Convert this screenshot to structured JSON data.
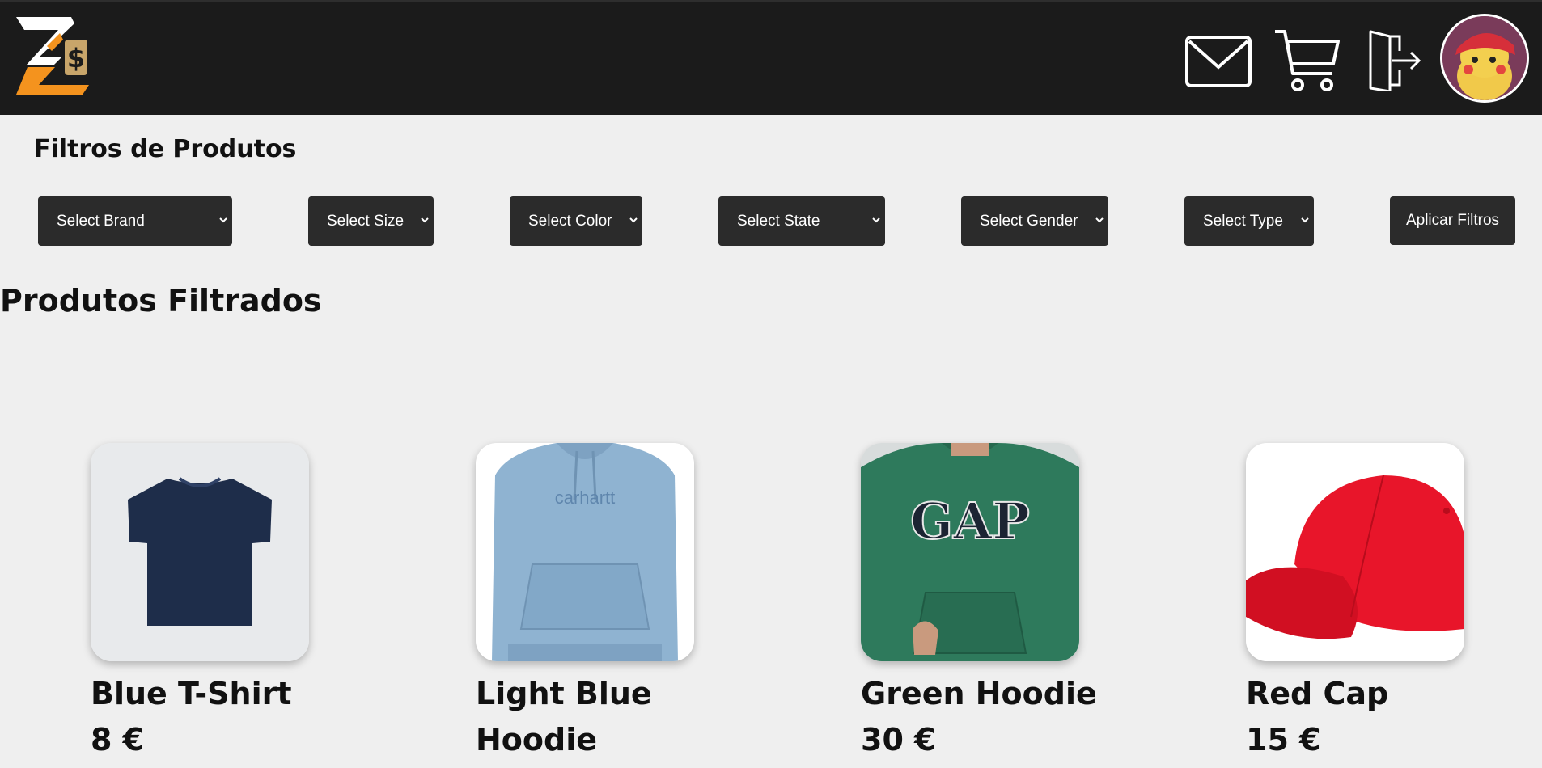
{
  "header": {
    "icons": [
      "logo-icon",
      "mail-icon",
      "cart-icon",
      "logout-icon",
      "avatar"
    ]
  },
  "filters": {
    "title": "Filtros de Produtos",
    "selects": [
      "Select Brand",
      "Select Size",
      "Select Color",
      "Select State",
      "Select Gender",
      "Select Type"
    ],
    "apply_label": "Aplicar Filtros"
  },
  "products": {
    "title": "Produtos Filtrados",
    "items": [
      {
        "name": "Blue T-Shirt",
        "price": "8 €",
        "color": "#1e2d4a"
      },
      {
        "name": "Light Blue Hoodie",
        "price": "",
        "color": "#8fb3d1"
      },
      {
        "name": "Green Hoodie",
        "price": "30 €",
        "color": "#2e7a5c"
      },
      {
        "name": "Red Cap",
        "price": "15 €",
        "color": "#e8152a"
      }
    ]
  },
  "colors": {
    "header_bg": "#1b1b1b",
    "page_bg": "#efefef",
    "control_bg": "#2b2b2b",
    "accent_orange": "#f4931e"
  }
}
